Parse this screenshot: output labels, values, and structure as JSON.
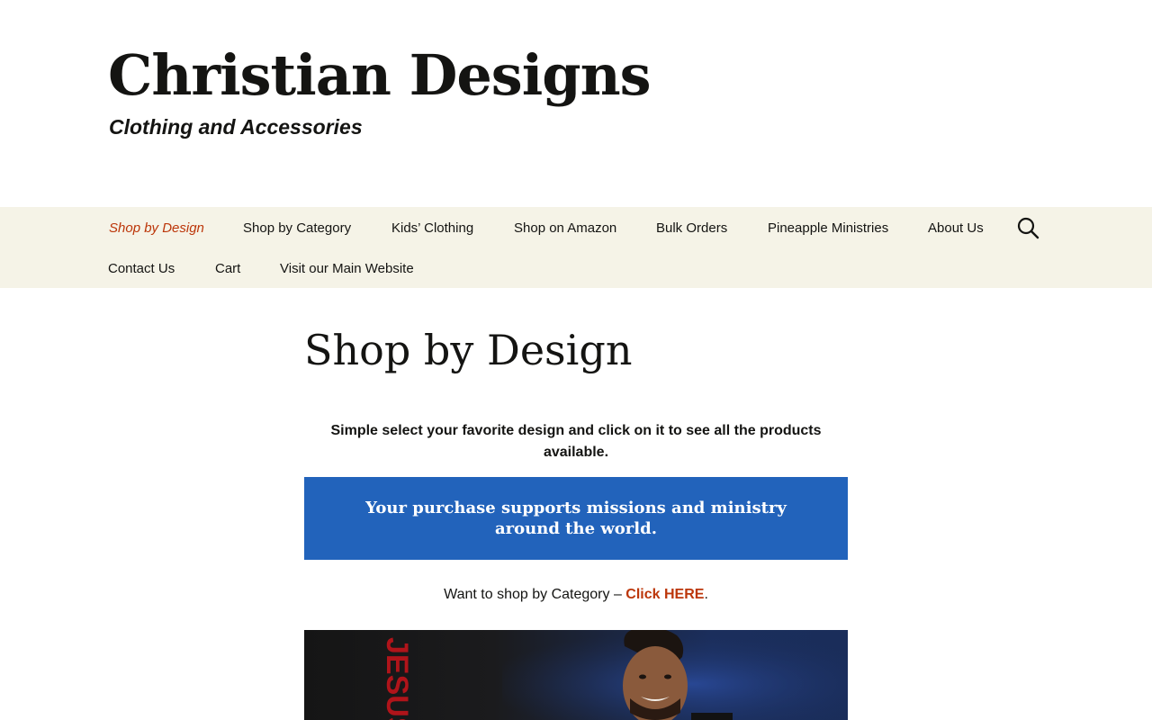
{
  "site": {
    "title": "Christian Designs",
    "description": "Clothing and Accessories"
  },
  "nav": {
    "items": [
      {
        "label": "Shop by Design",
        "active": true
      },
      {
        "label": "Shop by Category",
        "active": false
      },
      {
        "label": "Kids’ Clothing",
        "active": false
      },
      {
        "label": "Shop on Amazon",
        "active": false
      },
      {
        "label": "Bulk Orders",
        "active": false
      },
      {
        "label": "Pineapple Ministries",
        "active": false
      },
      {
        "label": "About Us",
        "active": false
      },
      {
        "label": "Contact Us",
        "active": false
      },
      {
        "label": "Cart",
        "active": false
      },
      {
        "label": "Visit our Main Website",
        "active": false
      }
    ],
    "search_icon": "search-icon"
  },
  "page": {
    "title": "Shop by Design",
    "intro": "Simple select your favorite design and click on it to see all the products available.",
    "banner_text": "Your purchase supports missions and ministry around the world.",
    "category_prefix": "Want to shop by Category – ",
    "category_link": "Click HERE",
    "category_suffix": ".",
    "image_text": "JESUS"
  },
  "colors": {
    "accent": "#bc360a",
    "nav_background": "#f5f3e7",
    "banner_background": "#2263bb",
    "text": "#141412"
  }
}
